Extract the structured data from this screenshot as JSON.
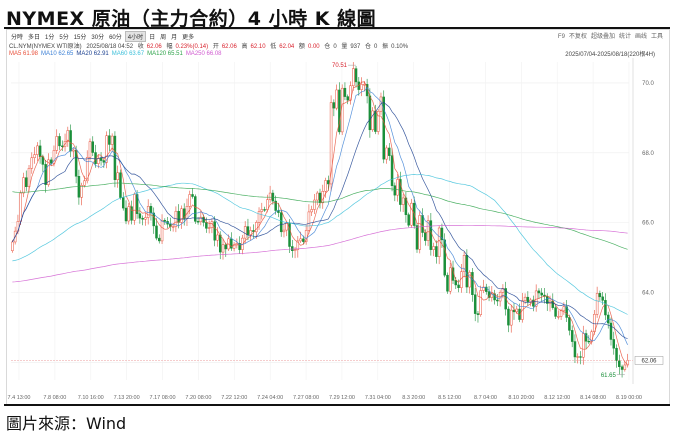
{
  "header": {
    "title": "NYMEX 原油（主力合約）4 小時 K 線圖"
  },
  "toolbar": {
    "periods": [
      "分時",
      "多日",
      "1分",
      "5分",
      "15分",
      "30分",
      "60分",
      "4小时",
      "日",
      "周",
      "月",
      "更多"
    ],
    "active_period": "4小时",
    "tools": [
      "F9",
      "不复权",
      "超级叠加",
      "统计",
      "画线",
      "工具"
    ]
  },
  "info": {
    "symbol": "CL.NYM(NYMEX WTI原油)",
    "datetime": "2025/08/18 04:52",
    "close_label": "收",
    "close": "62.06",
    "change_label": "幅",
    "change": "0.23%(0.14)",
    "open_label": "开",
    "open": "62.06",
    "high_label": "高",
    "high": "62.10",
    "low_label": "低",
    "low": "62.04",
    "amt_label": "额",
    "amt": "0.00",
    "hold_label": "仓",
    "hold": "0",
    "vol_label": "量",
    "vol": "937",
    "pos_label": "仓",
    "pos": "0",
    "swing_label": "振",
    "swing": "0.10%",
    "range_text": "2025/07/04-2025/08/18(220根4H)"
  },
  "ma_legend": [
    {
      "label": "MA5",
      "value": "61.98",
      "color": "#e8503a"
    },
    {
      "label": "MA10",
      "value": "62.65",
      "color": "#3a7fd5"
    },
    {
      "label": "MA20",
      "value": "62.91",
      "color": "#1a3f8f"
    },
    {
      "label": "MA60",
      "value": "63.67",
      "color": "#3bbfd9"
    },
    {
      "label": "MA120",
      "value": "65.51",
      "color": "#2ea34a"
    },
    {
      "label": "MA250",
      "value": "66.08",
      "color": "#d05ad0"
    }
  ],
  "colors": {
    "up": "#e8503a",
    "down": "#1a8f3a"
  },
  "source": "圖片來源：Wind",
  "chart_data": {
    "type": "candlestick",
    "ylim": [
      61.5,
      70.6
    ],
    "yticks": [
      62,
      64,
      66,
      68,
      70
    ],
    "ytick_labels": [
      "",
      "64.0",
      "66.0",
      "68.0",
      "70.0"
    ],
    "last_price": "62.06",
    "max_label": "70.51",
    "min_label": "61.65",
    "max_price": 70.51,
    "min_price": 61.65,
    "xtick_labels": [
      "7.4 13:00",
      "7.8 08:00",
      "7.10 16:00",
      "7.13 20:00",
      "7.17 08:00",
      "7.20 08:00",
      "7.22 12:00",
      "7.24 04:00",
      "7.27 08:00",
      "7.29 12:00",
      "7.31 04:00",
      "8.3 20:00",
      "8.5 12:00",
      "8.7 04:00",
      "8.10 20:00",
      "8.12 12:00",
      "8.14 08:00",
      "8.19 00:00"
    ],
    "closes": [
      65.45,
      65.76,
      66.04,
      66.85,
      67.29,
      67.03,
      67.56,
      67.86,
      67.95,
      68.2,
      67.89,
      67.67,
      67.09,
      67.8,
      67.7,
      68.07,
      68.47,
      68.2,
      68.18,
      68.33,
      68.64,
      68.05,
      68.08,
      67.33,
      66.73,
      67.07,
      67.2,
      67.87,
      68.32,
      68.01,
      67.69,
      67.85,
      67.78,
      67.73,
      68.49,
      68.24,
      68.48,
      67.23,
      67.43,
      66.72,
      66.42,
      66.05,
      66.46,
      66.07,
      66.81,
      66.26,
      66.13,
      66.1,
      66.15,
      66.47,
      66.28,
      65.91,
      65.56,
      65.48,
      66.07,
      66.04,
      65.96,
      65.89,
      65.89,
      66.33,
      66.01,
      66.4,
      66.12,
      66.47,
      66.81,
      66.75,
      66.04,
      66.03,
      66.16,
      66.01,
      65.84,
      65.86,
      66.03,
      65.5,
      65.65,
      65.16,
      65.37,
      65.25,
      65.54,
      65.27,
      65.37,
      65.41,
      65.23,
      65.56,
      65.89,
      65.66,
      65.78,
      65.74,
      66.01,
      66.32,
      66.38,
      66.37,
      66.66,
      66.85,
      66.62,
      66.35,
      66.29,
      65.74,
      65.79,
      65.98,
      65.32,
      65.2,
      65.23,
      65.48,
      65.54,
      65.46,
      65.78,
      66.31,
      66.38,
      66.65,
      66.85,
      66.57,
      66.9,
      67.21,
      67.11,
      69.44,
      69.28,
      69.8,
      68.6,
      69.85,
      69.61,
      69.51,
      69.92,
      70.41,
      70.03,
      69.81,
      69.96,
      69.96,
      69.63,
      68.66,
      69.2,
      68.61,
      69.19,
      69.6,
      67.82,
      68.14,
      67.92,
      67.06,
      66.79,
      67.24,
      66.52,
      66.71,
      66.23,
      65.93,
      66.56,
      65.92,
      65.24,
      66.21,
      65.72,
      65.49,
      66.06,
      65.23,
      65.32,
      65.03,
      65.85,
      65.51,
      64.5,
      64.04,
      64.71,
      64.35,
      64.22,
      64.14,
      64.6,
      65.07,
      64.16,
      64.58,
      63.94,
      63.4,
      63.37,
      64.06,
      64.16,
      64.03,
      63.86,
      63.97,
      63.79,
      63.76,
      64.01,
      64.12,
      63.53,
      63.07,
      63.5,
      63.45,
      63.53,
      63.23,
      63.77,
      63.87,
      63.74,
      63.79,
      63.61,
      64.05,
      63.99,
      63.93,
      63.89,
      63.69,
      63.76,
      63.57,
      63.32,
      63.32,
      63.48,
      63.6,
      63.29,
      62.92,
      62.6,
      62.16,
      62.17,
      62.15,
      62.83,
      62.61,
      62.59,
      62.88,
      63.38,
      63.98,
      63.88,
      63.78,
      63.36,
      63.13,
      62.66,
      62.41,
      62.05,
      61.88,
      61.8,
      61.93,
      62.06
    ]
  }
}
